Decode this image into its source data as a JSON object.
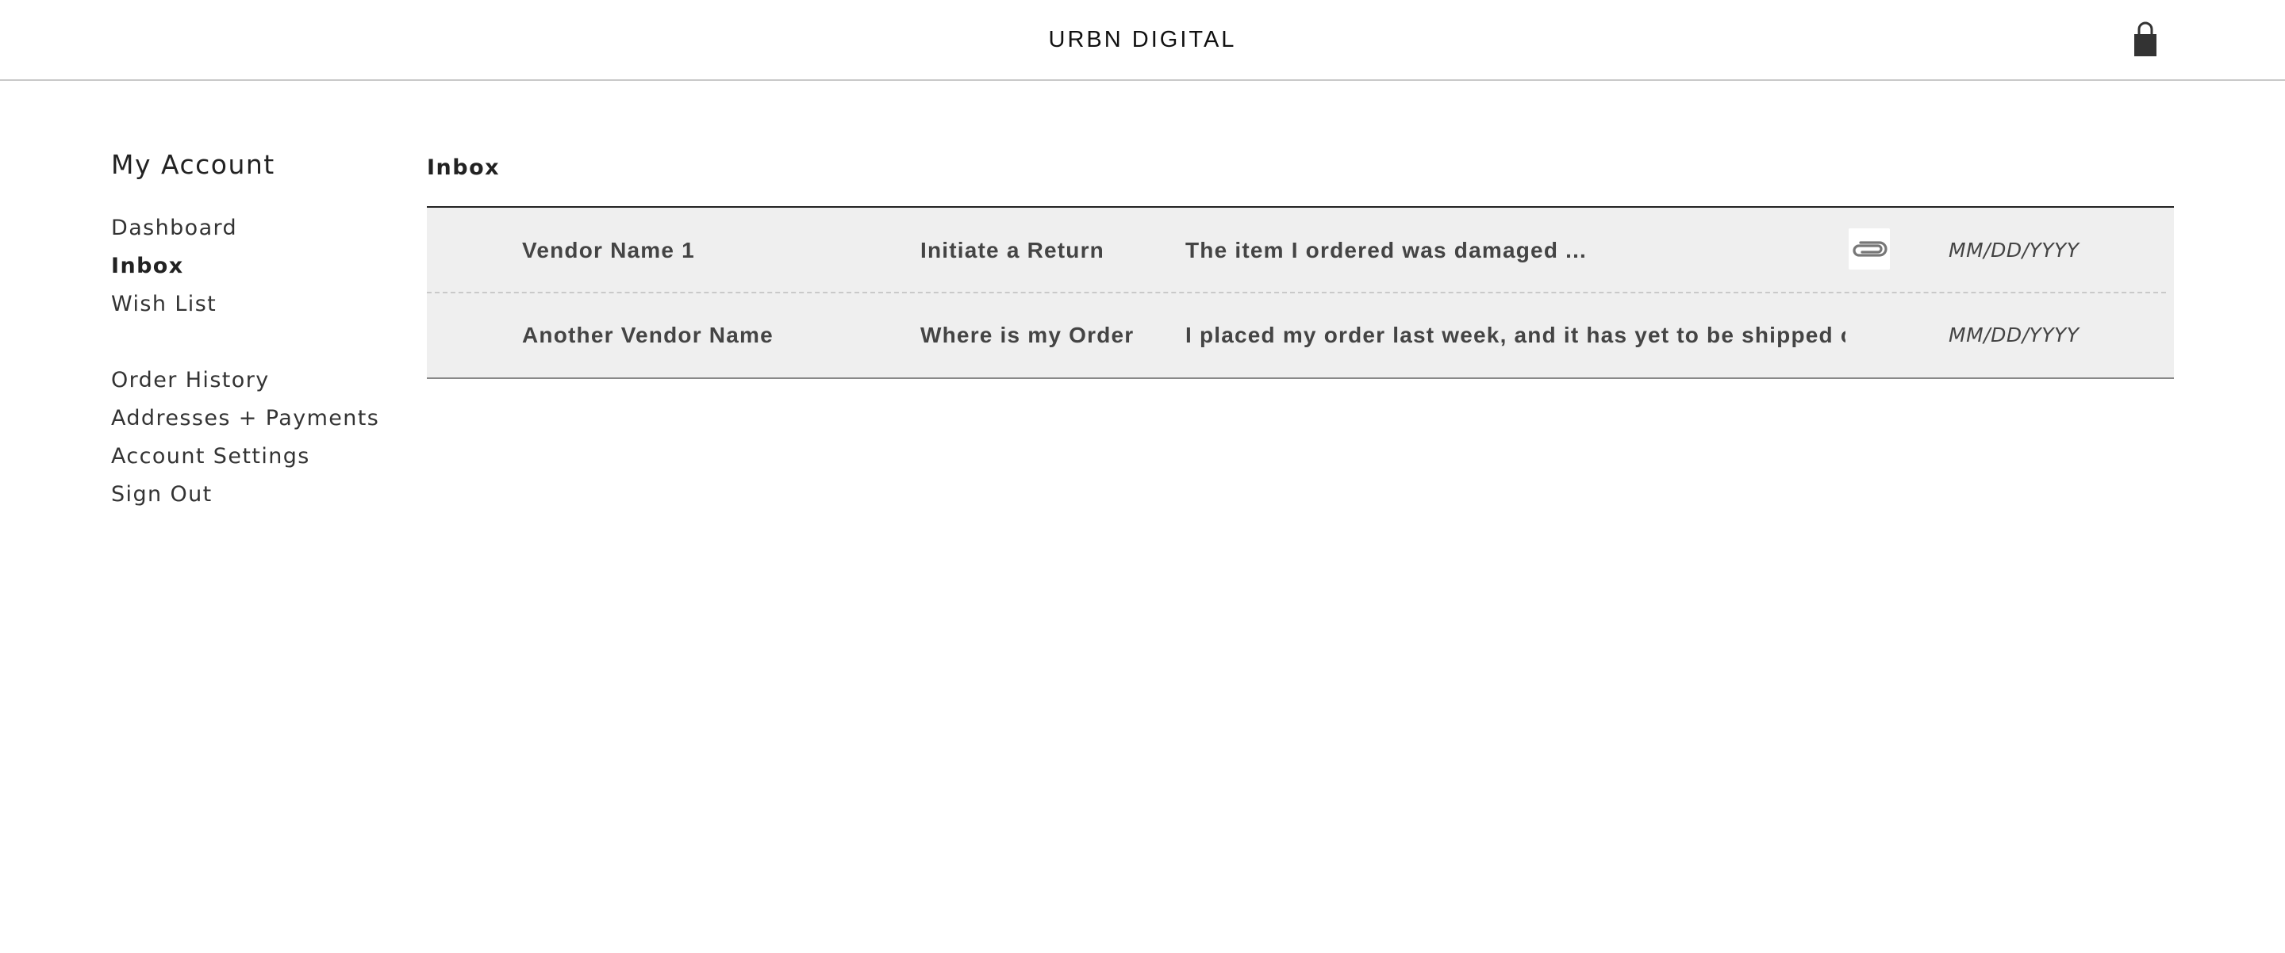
{
  "header": {
    "brand": "URBN DIGITAL",
    "cart_icon": "shopping-bag-icon"
  },
  "sidebar": {
    "title": "My Account",
    "primary_items": [
      {
        "label": "Dashboard",
        "active": false
      },
      {
        "label": "Inbox",
        "active": true
      },
      {
        "label": "Wish List",
        "active": false
      }
    ],
    "secondary_items": [
      {
        "label": "Order History"
      },
      {
        "label": "Addresses + Payments"
      },
      {
        "label": "Account Settings"
      },
      {
        "label": "Sign Out"
      }
    ]
  },
  "main": {
    "title": "Inbox",
    "messages": [
      {
        "vendor": "Vendor Name 1",
        "subject": "Initiate a Return",
        "preview": "The item I ordered was damaged ...",
        "has_attachment": true,
        "attachment_icon": "paperclip-icon",
        "date": "MM/DD/YYYY"
      },
      {
        "vendor": "Another Vendor Name",
        "subject": "Where is my Order",
        "preview": "I placed my order last week, and it has yet to be shipped o",
        "has_attachment": false,
        "date": "MM/DD/YYYY"
      }
    ]
  },
  "colors": {
    "row_background": "#efefef",
    "text": "#444444",
    "divider": "#222222"
  }
}
